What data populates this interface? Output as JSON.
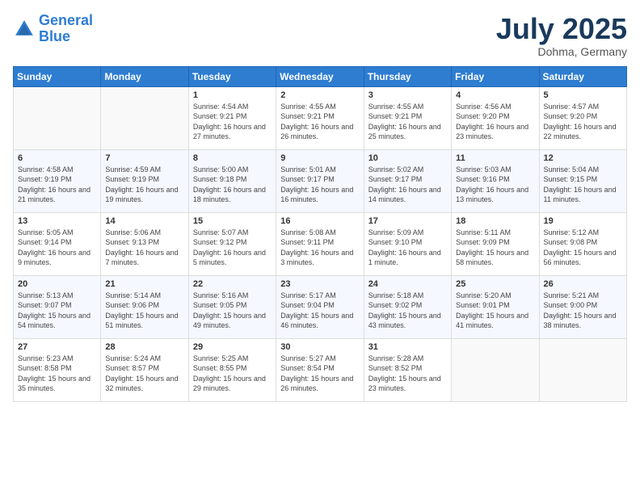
{
  "header": {
    "logo_line1": "General",
    "logo_line2": "Blue",
    "month_title": "July 2025",
    "location": "Dohma, Germany"
  },
  "days_of_week": [
    "Sunday",
    "Monday",
    "Tuesday",
    "Wednesday",
    "Thursday",
    "Friday",
    "Saturday"
  ],
  "weeks": [
    [
      {
        "day": "",
        "info": ""
      },
      {
        "day": "",
        "info": ""
      },
      {
        "day": "1",
        "info": "Sunrise: 4:54 AM\nSunset: 9:21 PM\nDaylight: 16 hours and 27 minutes."
      },
      {
        "day": "2",
        "info": "Sunrise: 4:55 AM\nSunset: 9:21 PM\nDaylight: 16 hours and 26 minutes."
      },
      {
        "day": "3",
        "info": "Sunrise: 4:55 AM\nSunset: 9:21 PM\nDaylight: 16 hours and 25 minutes."
      },
      {
        "day": "4",
        "info": "Sunrise: 4:56 AM\nSunset: 9:20 PM\nDaylight: 16 hours and 23 minutes."
      },
      {
        "day": "5",
        "info": "Sunrise: 4:57 AM\nSunset: 9:20 PM\nDaylight: 16 hours and 22 minutes."
      }
    ],
    [
      {
        "day": "6",
        "info": "Sunrise: 4:58 AM\nSunset: 9:19 PM\nDaylight: 16 hours and 21 minutes."
      },
      {
        "day": "7",
        "info": "Sunrise: 4:59 AM\nSunset: 9:19 PM\nDaylight: 16 hours and 19 minutes."
      },
      {
        "day": "8",
        "info": "Sunrise: 5:00 AM\nSunset: 9:18 PM\nDaylight: 16 hours and 18 minutes."
      },
      {
        "day": "9",
        "info": "Sunrise: 5:01 AM\nSunset: 9:17 PM\nDaylight: 16 hours and 16 minutes."
      },
      {
        "day": "10",
        "info": "Sunrise: 5:02 AM\nSunset: 9:17 PM\nDaylight: 16 hours and 14 minutes."
      },
      {
        "day": "11",
        "info": "Sunrise: 5:03 AM\nSunset: 9:16 PM\nDaylight: 16 hours and 13 minutes."
      },
      {
        "day": "12",
        "info": "Sunrise: 5:04 AM\nSunset: 9:15 PM\nDaylight: 16 hours and 11 minutes."
      }
    ],
    [
      {
        "day": "13",
        "info": "Sunrise: 5:05 AM\nSunset: 9:14 PM\nDaylight: 16 hours and 9 minutes."
      },
      {
        "day": "14",
        "info": "Sunrise: 5:06 AM\nSunset: 9:13 PM\nDaylight: 16 hours and 7 minutes."
      },
      {
        "day": "15",
        "info": "Sunrise: 5:07 AM\nSunset: 9:12 PM\nDaylight: 16 hours and 5 minutes."
      },
      {
        "day": "16",
        "info": "Sunrise: 5:08 AM\nSunset: 9:11 PM\nDaylight: 16 hours and 3 minutes."
      },
      {
        "day": "17",
        "info": "Sunrise: 5:09 AM\nSunset: 9:10 PM\nDaylight: 16 hours and 1 minute."
      },
      {
        "day": "18",
        "info": "Sunrise: 5:11 AM\nSunset: 9:09 PM\nDaylight: 15 hours and 58 minutes."
      },
      {
        "day": "19",
        "info": "Sunrise: 5:12 AM\nSunset: 9:08 PM\nDaylight: 15 hours and 56 minutes."
      }
    ],
    [
      {
        "day": "20",
        "info": "Sunrise: 5:13 AM\nSunset: 9:07 PM\nDaylight: 15 hours and 54 minutes."
      },
      {
        "day": "21",
        "info": "Sunrise: 5:14 AM\nSunset: 9:06 PM\nDaylight: 15 hours and 51 minutes."
      },
      {
        "day": "22",
        "info": "Sunrise: 5:16 AM\nSunset: 9:05 PM\nDaylight: 15 hours and 49 minutes."
      },
      {
        "day": "23",
        "info": "Sunrise: 5:17 AM\nSunset: 9:04 PM\nDaylight: 15 hours and 46 minutes."
      },
      {
        "day": "24",
        "info": "Sunrise: 5:18 AM\nSunset: 9:02 PM\nDaylight: 15 hours and 43 minutes."
      },
      {
        "day": "25",
        "info": "Sunrise: 5:20 AM\nSunset: 9:01 PM\nDaylight: 15 hours and 41 minutes."
      },
      {
        "day": "26",
        "info": "Sunrise: 5:21 AM\nSunset: 9:00 PM\nDaylight: 15 hours and 38 minutes."
      }
    ],
    [
      {
        "day": "27",
        "info": "Sunrise: 5:23 AM\nSunset: 8:58 PM\nDaylight: 15 hours and 35 minutes."
      },
      {
        "day": "28",
        "info": "Sunrise: 5:24 AM\nSunset: 8:57 PM\nDaylight: 15 hours and 32 minutes."
      },
      {
        "day": "29",
        "info": "Sunrise: 5:25 AM\nSunset: 8:55 PM\nDaylight: 15 hours and 29 minutes."
      },
      {
        "day": "30",
        "info": "Sunrise: 5:27 AM\nSunset: 8:54 PM\nDaylight: 15 hours and 26 minutes."
      },
      {
        "day": "31",
        "info": "Sunrise: 5:28 AM\nSunset: 8:52 PM\nDaylight: 15 hours and 23 minutes."
      },
      {
        "day": "",
        "info": ""
      },
      {
        "day": "",
        "info": ""
      }
    ]
  ]
}
